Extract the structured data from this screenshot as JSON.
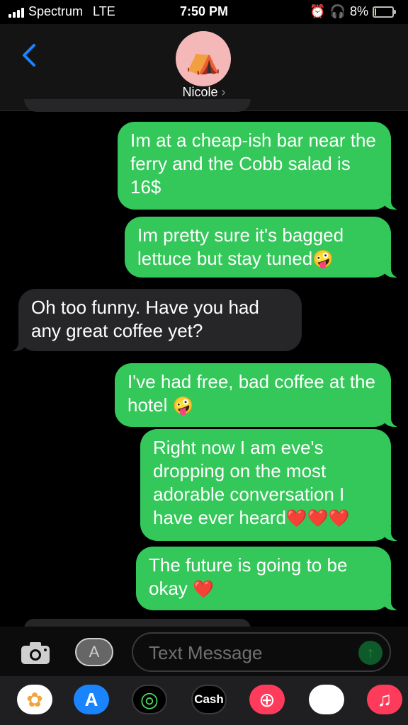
{
  "status": {
    "carrier": "Spectrum",
    "network": "LTE",
    "time": "7:50 PM",
    "battery_pct": "8%",
    "battery_level": 0.08
  },
  "header": {
    "contact_name": "Nicole",
    "avatar_emoji": "⛺",
    "chevron": "›"
  },
  "messages": [
    {
      "direction": "outgoing",
      "text": "Im at a cheap-ish bar near the ferry and the Cobb salad is 16$"
    },
    {
      "direction": "outgoing",
      "text": "Im pretty sure it's bagged lettuce but stay tuned",
      "emoji": "🤪"
    },
    {
      "direction": "incoming",
      "text": "Oh too funny.  Have you had any great coffee yet?"
    },
    {
      "direction": "outgoing",
      "text": "I've had free, bad coffee at the hotel ",
      "emoji": "🤪"
    },
    {
      "direction": "outgoing",
      "text": "Right now I am eve's dropping on the most adorable conversation I have ever heard",
      "emoji": "❤️❤️❤️"
    },
    {
      "direction": "outgoing",
      "text": "The future is going to be okay ",
      "emoji": "❤️"
    }
  ],
  "input": {
    "placeholder": "Text Message",
    "send_glyph": "↑",
    "apps_glyph": "A"
  },
  "dock": {
    "apps": [
      {
        "name": "Photos",
        "glyph": "✿",
        "color": "#ffffff"
      },
      {
        "name": "App Store",
        "glyph": "A",
        "color": "#1a84ff"
      },
      {
        "name": "Activity",
        "glyph": "◎",
        "color": "#000000"
      },
      {
        "name": "Cash",
        "label": "Cash",
        "color": "#000000"
      },
      {
        "name": "Search",
        "glyph": "⊕",
        "color": "#ff3b5c"
      },
      {
        "name": "Memoji",
        "glyph": "😍",
        "color": "#ffffff"
      },
      {
        "name": "Music",
        "glyph": "♫",
        "color": "#ff3b5c"
      }
    ]
  },
  "colors": {
    "outgoing_bubble": "#34c759",
    "incoming_bubble": "#262628",
    "accent_blue": "#1a84ff"
  }
}
